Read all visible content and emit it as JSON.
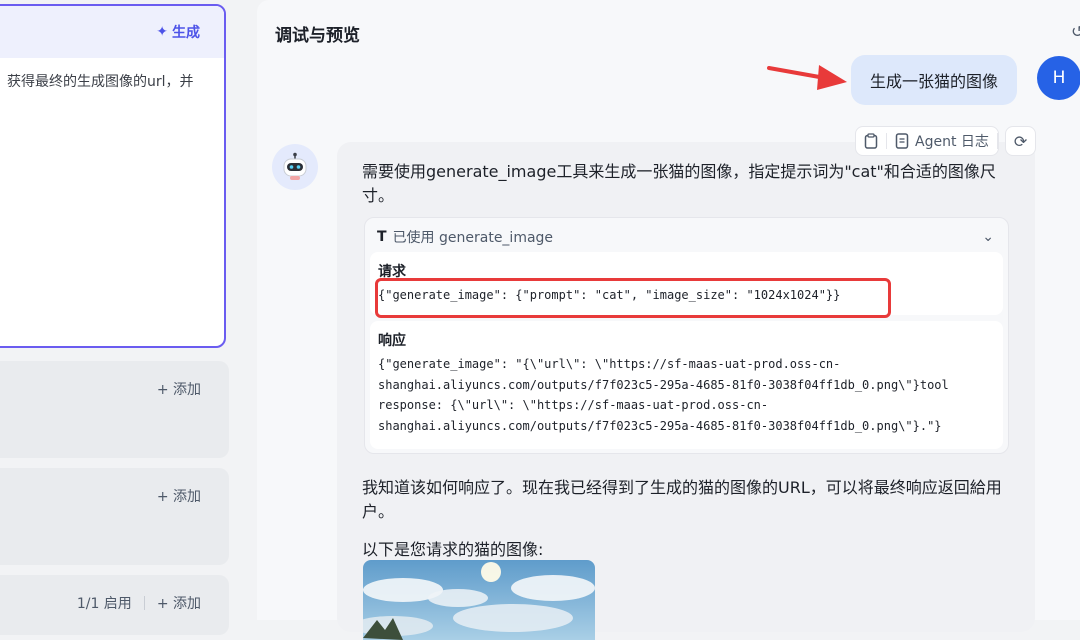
{
  "left": {
    "generate_label": "生成",
    "prompt_text": "获得最终的生成图像的url，并",
    "sections": [
      {
        "add_label": "添加"
      },
      {
        "add_label": "添加"
      },
      {
        "status": "1/1 启用",
        "add_label": "添加"
      }
    ]
  },
  "right": {
    "title": "调试与预览",
    "user_message": "生成一张猫的图像",
    "user_avatar_letter": "H",
    "toolbar": {
      "log_label": "Agent 日志"
    },
    "bot": {
      "text1": "需要使用generate_image工具来生成一张猫的图像，指定提示词为\"cat\"和合适的图像尺寸。",
      "tool_used": "已使用 generate_image",
      "request_label": "请求",
      "request_code": "{\"generate_image\": {\"prompt\": \"cat\", \"image_size\": \"1024x1024\"}}",
      "response_label": "响应",
      "response_code": "{\"generate_image\": \"{\\\"url\\\": \\\"https://sf-maas-uat-prod.oss-cn-\nshanghai.aliyuncs.com/outputs/f7f023c5-295a-4685-81f0-3038f04ff1db_0.png\\\"}tool\nresponse: {\\\"url\\\": \\\"https://sf-maas-uat-prod.oss-cn-\nshanghai.aliyuncs.com/outputs/f7f023c5-295a-4685-81f0-3038f04ff1db_0.png\\\"}.\"}",
      "text2": "我知道该如何响应了。现在我已经得到了生成的猫的图像的URL，可以将最终响应返回給用户。",
      "text3": "以下是您请求的猫的图像:"
    }
  },
  "colors": {
    "accent": "#4d53e8",
    "focus_border": "#6a5cf0",
    "user_avatar": "#2662e6",
    "highlight_red": "#e83a3a"
  }
}
